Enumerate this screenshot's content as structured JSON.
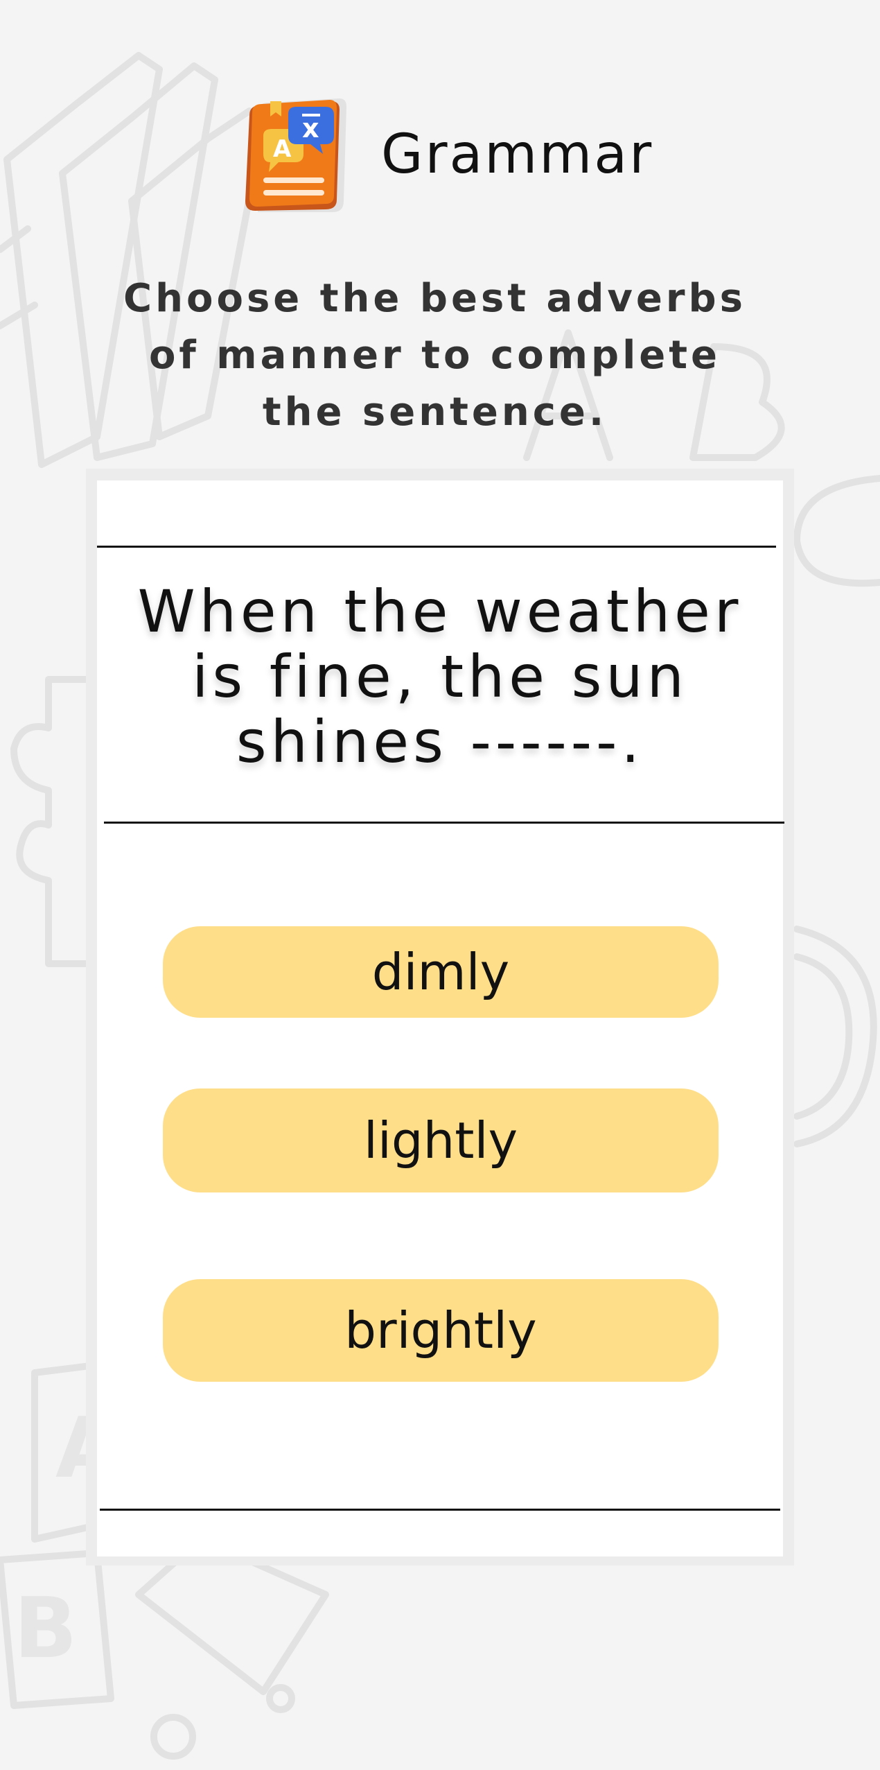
{
  "header": {
    "icon": "grammar-book-icon",
    "title": "Grammar"
  },
  "instructions": "Choose the best adverbs of manner to complete the sentence.",
  "question": "When the weather is fine, the sun shines ------.",
  "options": [
    {
      "label": "dimly"
    },
    {
      "label": "lightly"
    },
    {
      "label": "brightly"
    }
  ],
  "colors": {
    "background": "#f4f4f4",
    "card": "#ffffff",
    "option_fill": "#ffde8a",
    "icon_book": "#f07a18",
    "icon_bubble_blue": "#3b6fe0",
    "icon_bubble_yellow": "#f6c343"
  }
}
